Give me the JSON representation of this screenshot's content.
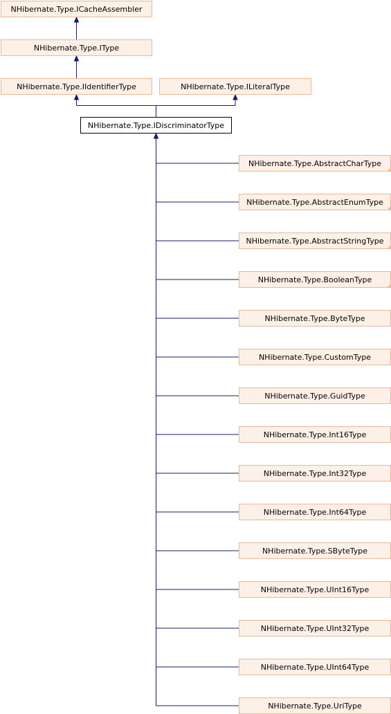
{
  "diagram": {
    "ancestors": [
      {
        "id": "icacheassembler",
        "label": "NHibernate.Type.ICacheAssembler"
      },
      {
        "id": "itype",
        "label": "NHibernate.Type.IType"
      },
      {
        "id": "iidentifiertype",
        "label": "NHibernate.Type.IIdentifierType"
      },
      {
        "id": "iliteraltype",
        "label": "NHibernate.Type.ILiteralType"
      }
    ],
    "current": {
      "id": "idiscriminatortype",
      "label": "NHibernate.Type.IDiscriminatorType"
    },
    "children": [
      {
        "id": "abstractchartype",
        "label": "NHibernate.Type.AbstractCharType",
        "has_more": true
      },
      {
        "id": "abstractenumtype",
        "label": "NHibernate.Type.AbstractEnumType",
        "has_more": true
      },
      {
        "id": "abstractstringtype",
        "label": "NHibernate.Type.AbstractStringType",
        "has_more": true
      },
      {
        "id": "booleantype",
        "label": "NHibernate.Type.BooleanType",
        "has_more": true
      },
      {
        "id": "bytetype",
        "label": "NHibernate.Type.ByteType",
        "has_more": false
      },
      {
        "id": "customtype",
        "label": "NHibernate.Type.CustomType",
        "has_more": false
      },
      {
        "id": "guidtype",
        "label": "NHibernate.Type.GuidType",
        "has_more": false
      },
      {
        "id": "int16type",
        "label": "NHibernate.Type.Int16Type",
        "has_more": false
      },
      {
        "id": "int32type",
        "label": "NHibernate.Type.Int32Type",
        "has_more": false
      },
      {
        "id": "int64type",
        "label": "NHibernate.Type.Int64Type",
        "has_more": false
      },
      {
        "id": "sbytetype",
        "label": "NHibernate.Type.SByteType",
        "has_more": false
      },
      {
        "id": "uint16type",
        "label": "NHibernate.Type.UInt16Type",
        "has_more": false
      },
      {
        "id": "uint32type",
        "label": "NHibernate.Type.UInt32Type",
        "has_more": false
      },
      {
        "id": "uint64type",
        "label": "NHibernate.Type.UInt64Type",
        "has_more": false
      },
      {
        "id": "uritype",
        "label": "NHibernate.Type.UriType",
        "has_more": false
      }
    ],
    "colors": {
      "node_fill": "#fdf0e6",
      "node_border": "#e8b89a",
      "current_border": "#000000",
      "edge": "#191970"
    }
  }
}
